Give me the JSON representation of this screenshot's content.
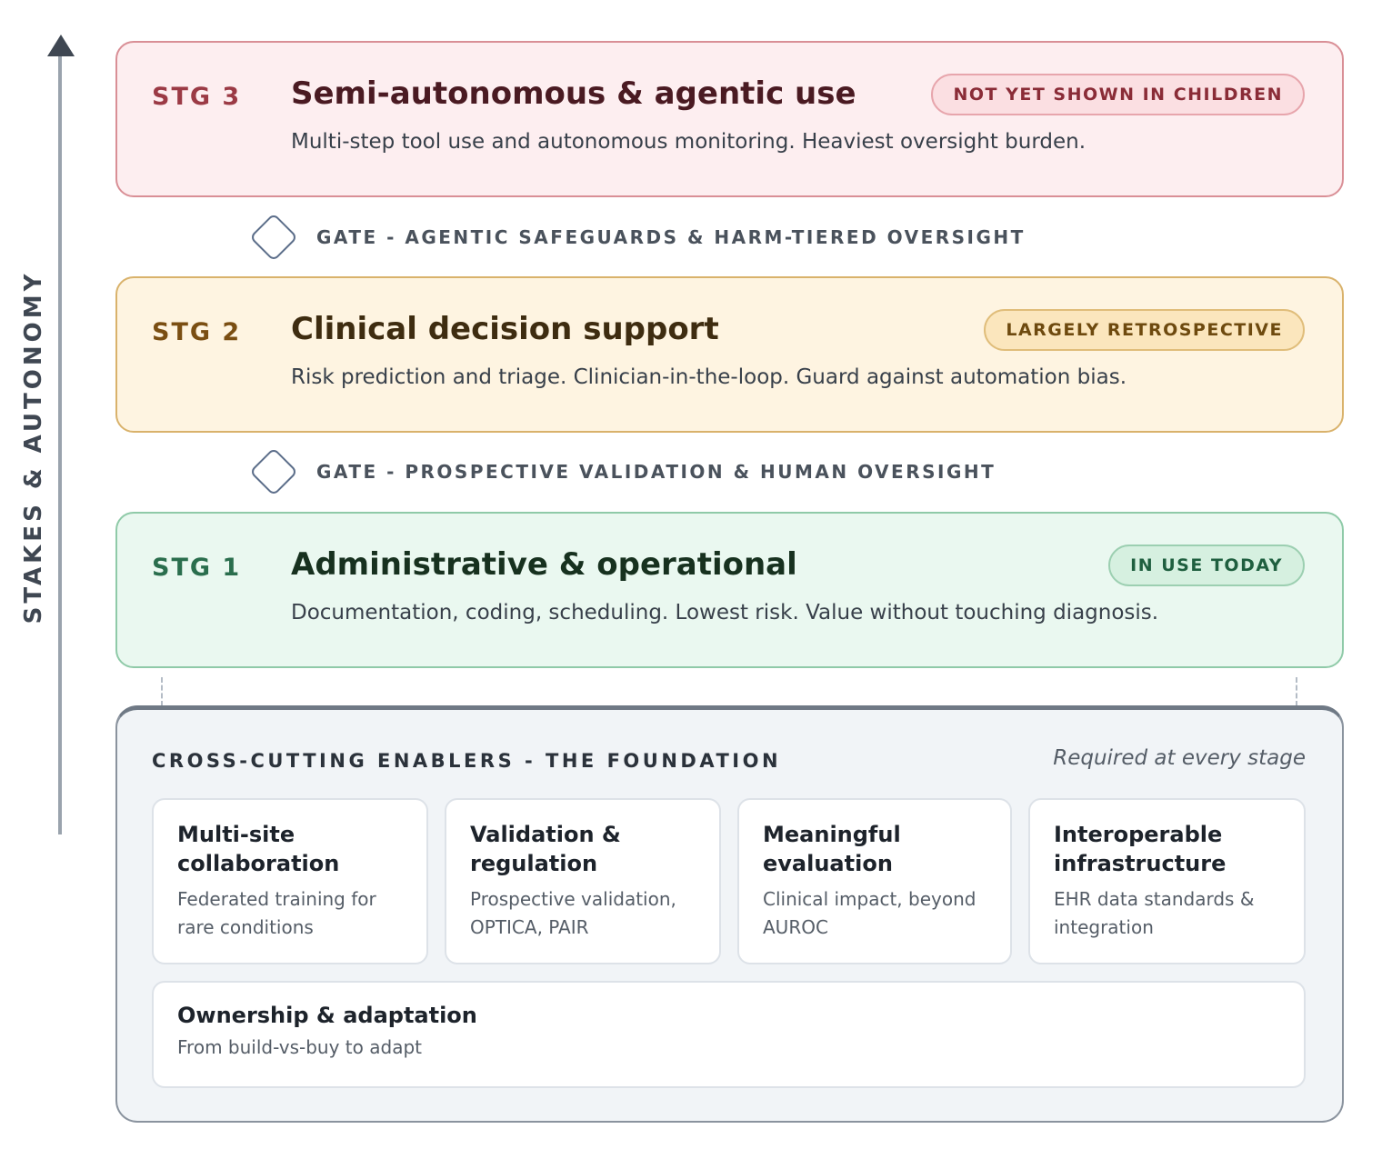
{
  "axis": {
    "label": "STAKES & AUTONOMY"
  },
  "stages": {
    "stg3": {
      "code": "STG 3",
      "title": "Semi-autonomous & agentic use",
      "badge": "NOT YET SHOWN IN CHILDREN",
      "description": "Multi-step tool use and autonomous monitoring. Heaviest oversight burden."
    },
    "stg2": {
      "code": "STG 2",
      "title": "Clinical decision support",
      "badge": "LARGELY RETROSPECTIVE",
      "description": "Risk prediction and triage. Clinician-in-the-loop. Guard against automation bias."
    },
    "stg1": {
      "code": "STG 1",
      "title": "Administrative & operational",
      "badge": "IN USE TODAY",
      "description": "Documentation, coding, scheduling. Lowest risk. Value without touching diagnosis."
    }
  },
  "gates": {
    "upper": "GATE - AGENTIC SAFEGUARDS & HARM-TIERED OVERSIGHT",
    "lower": "GATE - PROSPECTIVE VALIDATION & HUMAN OVERSIGHT"
  },
  "foundation": {
    "title": "CROSS-CUTTING ENABLERS - THE FOUNDATION",
    "subtitle": "Required at every stage",
    "enablers": [
      {
        "title": "Multi-site collaboration",
        "description": "Federated training for rare conditions"
      },
      {
        "title": "Validation & regulation",
        "description": "Prospective validation, OPTICA, PAIR"
      },
      {
        "title": "Meaningful evaluation",
        "description": "Clinical impact, beyond AUROC"
      },
      {
        "title": "Interoperable infrastructure",
        "description": "EHR data standards & integration"
      },
      {
        "title": "Ownership & adaptation",
        "description": "From build-vs-buy to adapt"
      }
    ]
  },
  "colors": {
    "stg3_bg": "#fdeef0",
    "stg2_bg": "#fef4e1",
    "stg1_bg": "#eaf8f0",
    "foundation_bg": "#f1f4f7",
    "axis": "#3f4752"
  }
}
